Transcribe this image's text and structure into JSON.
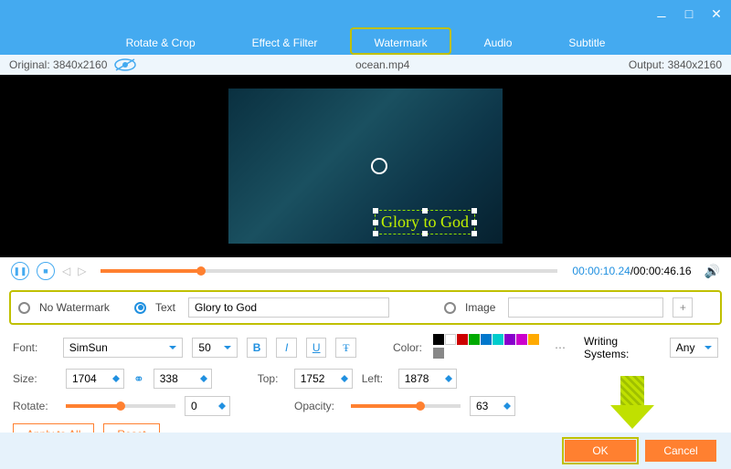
{
  "window": {
    "minimize": "—",
    "maximize": "□",
    "close": "✕"
  },
  "tabs": [
    "Rotate & Crop",
    "Effect & Filter",
    "Watermark",
    "Audio",
    "Subtitle"
  ],
  "active_tab": 2,
  "info": {
    "original": "Original: 3840x2160",
    "file": "ocean.mp4",
    "output": "Output: 3840x2160"
  },
  "watermark_text": "Glory to God",
  "time": {
    "current": "00:00:10.24",
    "total": "/00:00:46.16"
  },
  "wm": {
    "none": "No Watermark",
    "text": "Text",
    "image": "Image",
    "text_value": "Glory to God",
    "image_value": "",
    "selected": "text"
  },
  "font": {
    "label": "Font:",
    "family": "SimSun",
    "size": "50"
  },
  "color_label": "Color:",
  "writing": {
    "label": "Writing Systems:",
    "value": "Any"
  },
  "size": {
    "label": "Size:",
    "w": "1704",
    "h": "338"
  },
  "pos": {
    "top_label": "Top:",
    "top": "1752",
    "left_label": "Left:",
    "left": "1878"
  },
  "rotate": {
    "label": "Rotate:",
    "value": "0",
    "pct": 50
  },
  "opacity": {
    "label": "Opacity:",
    "value": "63",
    "pct": 63
  },
  "apply": "Apply to All",
  "reset": "Reset",
  "ok": "OK",
  "cancel": "Cancel",
  "swatches": [
    "#000",
    "#fff",
    "#c00",
    "#0a0",
    "#07c",
    "#0cc",
    "#80c",
    "#c0c",
    "#fa0",
    "#888"
  ]
}
